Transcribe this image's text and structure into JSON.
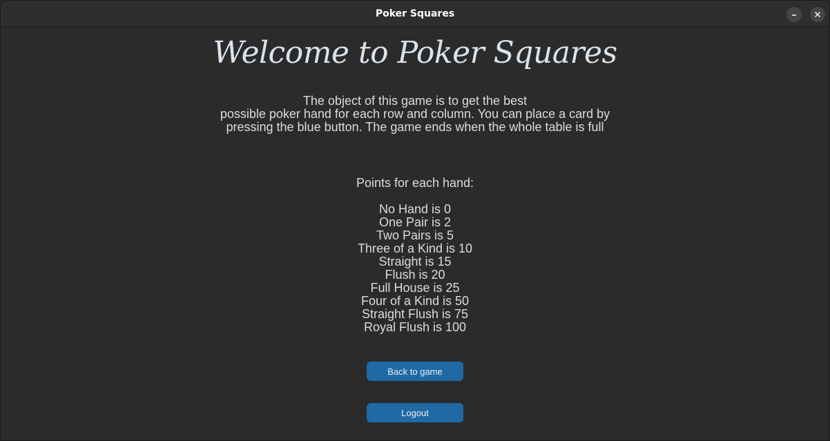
{
  "window": {
    "title": "Poker Squares",
    "minimize_label": "–",
    "close_label": "✕"
  },
  "heading": "Welcome to Poker Squares",
  "description": {
    "lines": [
      "The object of this game is to get the best",
      "possible poker hand for each row and column. You can place a card by",
      "pressing the blue button. The game ends when the whole table is full"
    ]
  },
  "points": {
    "title": "Points for each hand:",
    "items": [
      "No Hand is 0",
      "One Pair is 2",
      "Two Pairs is 5",
      "Three of a Kind is 10",
      "Straight is 15",
      "Flush is 20",
      "Full House is 25",
      "Four of a Kind is 50",
      "Straight Flush is 75",
      "Royal Flush is 100"
    ]
  },
  "buttons": {
    "back_label": "Back to game",
    "logout_label": "Logout"
  },
  "colors": {
    "background": "#2b2b2b",
    "button": "#1f6aa5",
    "text": "#dcdcdc"
  }
}
